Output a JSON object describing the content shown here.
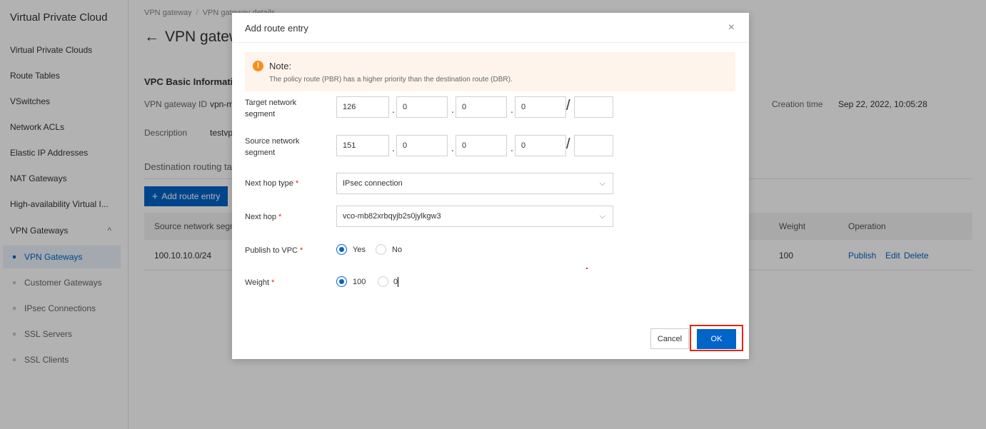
{
  "sidebar": {
    "title": "Virtual Private Cloud",
    "items": [
      {
        "label": "Virtual Private Clouds"
      },
      {
        "label": "Route Tables"
      },
      {
        "label": "VSwitches"
      },
      {
        "label": "Network ACLs"
      },
      {
        "label": "Elastic IP Addresses"
      },
      {
        "label": "NAT Gateways"
      },
      {
        "label": "High-availability Virtual I..."
      }
    ],
    "group": {
      "label": "VPN Gateways",
      "toggle": "^"
    },
    "subitems": [
      {
        "label": "VPN Gateways"
      },
      {
        "label": "Customer Gateways"
      },
      {
        "label": "IPsec Connections"
      },
      {
        "label": "SSL Servers"
      },
      {
        "label": "SSL Clients"
      }
    ]
  },
  "main": {
    "breadcrumb": [
      "VPN gateway",
      "/",
      "VPN gateway details"
    ],
    "title": "VPN gatew",
    "back_icon": "←",
    "section_title": "VPC Basic Informatio",
    "gateway_id_label": "VPN gateway ID",
    "gateway_id_value": "vpn-m",
    "description_label": "Description",
    "description_value": "testvp",
    "creation_time_label": "Creation time",
    "creation_time_value": "Sep 22, 2022, 10:05:28",
    "tab_title": "Destination routing ta",
    "add_button": "Add route entry",
    "add_icon": "+",
    "table": {
      "columns": [
        "Source network segme",
        "Weight",
        "Operation"
      ],
      "rows": [
        {
          "source": "100.10.10.0/24",
          "weight": "100",
          "actions": [
            "Publish",
            "Edit",
            "Delete"
          ]
        }
      ]
    }
  },
  "modal": {
    "title": "Add route entry",
    "close_icon": "×",
    "note": {
      "icon": "!",
      "title": "Note:",
      "text": "The policy route (PBR) has a higher priority than the destination route (DBR)."
    },
    "fields": {
      "target_segment": {
        "label": "Target network segment",
        "octets": [
          "126",
          "0",
          "0",
          "0"
        ],
        "mask": ""
      },
      "source_segment": {
        "label": "Source network segment",
        "octets": [
          "151",
          "0",
          "0",
          "0"
        ],
        "mask": ""
      },
      "next_hop_type": {
        "label": "Next hop type",
        "required": "*",
        "value": "IPsec connection"
      },
      "next_hop": {
        "label": "Next hop",
        "required": "*",
        "value": "vco-mb82xrbqyjb2s0jylkgw3"
      },
      "publish_to_vpc": {
        "label": "Publish to VPC",
        "required": "*",
        "options": [
          "Yes",
          "No"
        ],
        "selected": "Yes"
      },
      "weight": {
        "label": "Weight",
        "required": "*",
        "options": [
          "100",
          "0"
        ],
        "selected": "100"
      }
    },
    "separators": {
      "dot": ".",
      "slash": "/"
    },
    "chevron": "⌵",
    "cancel_button": "Cancel",
    "ok_button": "OK"
  },
  "colors": {
    "accent": "#0064c8",
    "highlight": "#e62412",
    "note_bg": "#fef4ec",
    "note_icon": "#f98e1a"
  }
}
